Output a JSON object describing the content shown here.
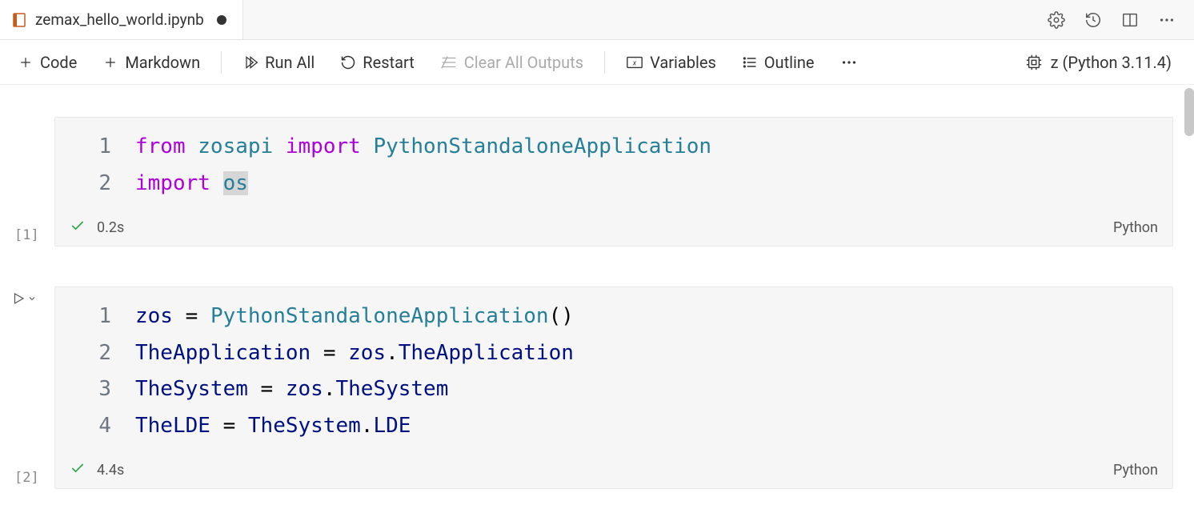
{
  "tab": {
    "title": "zemax_hello_world.ipynb",
    "dirty": true
  },
  "toolbar": {
    "code": "Code",
    "markdown": "Markdown",
    "runAll": "Run All",
    "restart": "Restart",
    "clearAll": "Clear All Outputs",
    "variables": "Variables",
    "outline": "Outline"
  },
  "kernel": {
    "label": "z (Python 3.11.4)"
  },
  "cells": [
    {
      "execCount": "[1]",
      "duration": "0.2s",
      "language": "Python",
      "lines": [
        {
          "n": "1",
          "tokens": [
            {
              "t": "from ",
              "c": "tok-keyword"
            },
            {
              "t": "zosapi ",
              "c": "tok-module"
            },
            {
              "t": "import ",
              "c": "tok-keyword"
            },
            {
              "t": "PythonStandaloneApplication",
              "c": "tok-class"
            }
          ]
        },
        {
          "n": "2",
          "tokens": [
            {
              "t": "import ",
              "c": "tok-keyword"
            },
            {
              "t": "os",
              "c": "tok-module tok-hl"
            }
          ]
        }
      ]
    },
    {
      "execCount": "[2]",
      "duration": "4.4s",
      "language": "Python",
      "showRun": true,
      "lines": [
        {
          "n": "1",
          "tokens": [
            {
              "t": "zos ",
              "c": "tok-var"
            },
            {
              "t": "= ",
              "c": "tok-punct"
            },
            {
              "t": "PythonStandaloneApplication",
              "c": "tok-class"
            },
            {
              "t": "()",
              "c": "tok-punct"
            }
          ]
        },
        {
          "n": "2",
          "tokens": [
            {
              "t": "TheApplication ",
              "c": "tok-var"
            },
            {
              "t": "= ",
              "c": "tok-punct"
            },
            {
              "t": "zos",
              "c": "tok-var"
            },
            {
              "t": ".",
              "c": "tok-punct"
            },
            {
              "t": "TheApplication",
              "c": "tok-prop"
            }
          ]
        },
        {
          "n": "3",
          "tokens": [
            {
              "t": "TheSystem ",
              "c": "tok-var"
            },
            {
              "t": "= ",
              "c": "tok-punct"
            },
            {
              "t": "zos",
              "c": "tok-var"
            },
            {
              "t": ".",
              "c": "tok-punct"
            },
            {
              "t": "TheSystem",
              "c": "tok-prop"
            }
          ]
        },
        {
          "n": "4",
          "tokens": [
            {
              "t": "TheLDE ",
              "c": "tok-var"
            },
            {
              "t": "= ",
              "c": "tok-punct"
            },
            {
              "t": "TheSystem",
              "c": "tok-var"
            },
            {
              "t": ".",
              "c": "tok-punct"
            },
            {
              "t": "LDE",
              "c": "tok-prop"
            }
          ]
        }
      ]
    }
  ]
}
